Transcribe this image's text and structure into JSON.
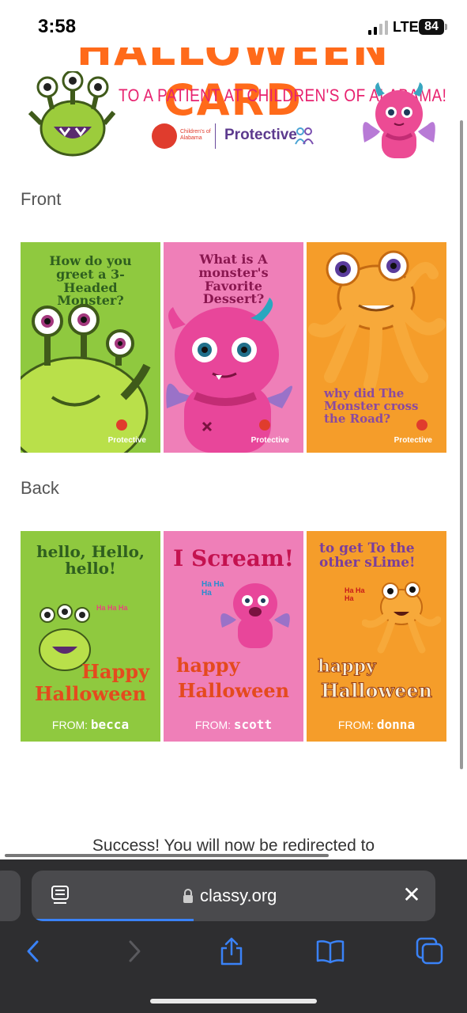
{
  "status_bar": {
    "time": "3:58",
    "network": "LTE",
    "battery": "84"
  },
  "banner": {
    "title": "HALLOWEEN CARD",
    "subtitle": "TO A PATIENT AT CHILDREN'S OF ALABAMA!",
    "childrens_logo": "Children's of Alabama",
    "protective": "Protective",
    "colors": {
      "title": "#ff6a1a",
      "subtitle": "#e7226f",
      "protective": "#5c3a8e"
    }
  },
  "front": {
    "label": "Front",
    "cards": [
      {
        "text": "How do you greet a 3-Headed Monster?",
        "brand": "Protective"
      },
      {
        "text": "What is A monster's Favorite Dessert?",
        "brand": "Protective"
      },
      {
        "text": "why did The Monster cross the Road?",
        "brand": "Protective"
      }
    ]
  },
  "back": {
    "label": "Back",
    "cards": [
      {
        "text": "hello, Hello, hello!",
        "laugh": "Ha Ha Ha",
        "greeting_1": "Happy",
        "greeting_2": "Halloween",
        "from_label": "FROM:",
        "from_name": "becca"
      },
      {
        "text": "I Scream!",
        "laugh": "Ha Ha Ha",
        "greeting_1": "happy",
        "greeting_2": "Halloween",
        "from_label": "FROM:",
        "from_name": "scott"
      },
      {
        "text": "to get To the other sLime!",
        "laugh": "Ha Ha Ha",
        "greeting_1": "happy",
        "greeting_2": "Halloween",
        "from_label": "FROM:",
        "from_name": "donna"
      }
    ]
  },
  "success_message": "Success! You will now be redirected to",
  "browser": {
    "url": "classy.org",
    "accent": "#3a82f7"
  }
}
